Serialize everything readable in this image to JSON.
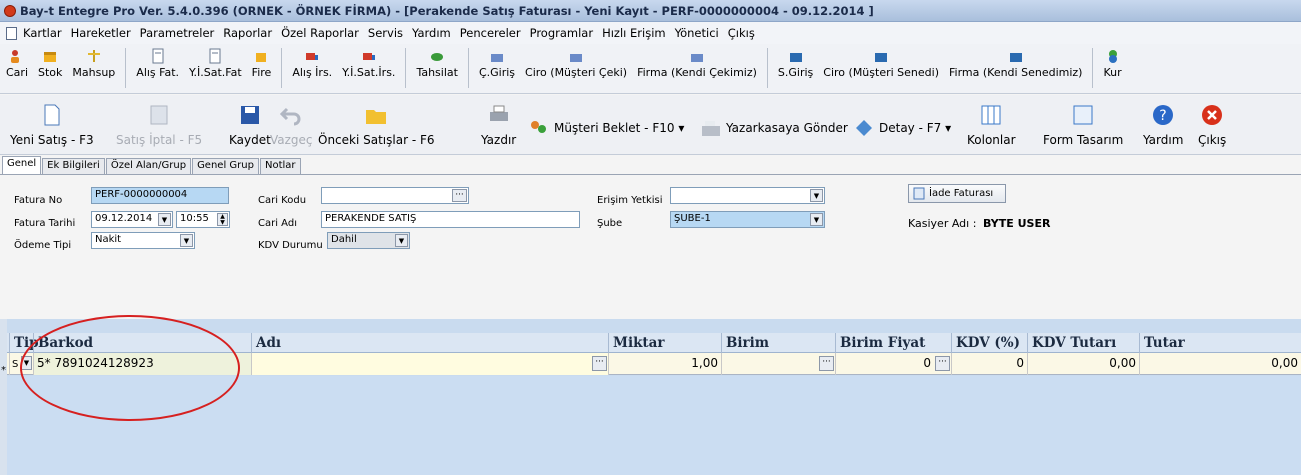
{
  "window": {
    "title": "Bay-t Entegre Pro Ver. 5.4.0.396 (ORNEK - ÖRNEK FİRMA) - [Perakende Satış Faturası - Yeni Kayıt - PERF-0000000004 - 09.12.2014 ]"
  },
  "menu": [
    "Kartlar",
    "Hareketler",
    "Parametreler",
    "Raporlar",
    "Özel Raporlar",
    "Servis",
    "Yardım",
    "Pencereler",
    "Programlar",
    "Hızlı Erişim",
    "Yönetici",
    "Çıkış"
  ],
  "toolbar1": [
    "Cari",
    "Stok",
    "Mahsup",
    "Alış Fat.",
    "Y.İ.Sat.Fat",
    "Fire",
    "Alış İrs.",
    "Y.İ.Sat.İrs.",
    "Tahsilat",
    "Ç.Giriş",
    "Ciro (Müşteri Çeki)",
    "Firma (Kendi Çekimiz)",
    "S.Giriş",
    "Ciro (Müşteri Senedi)",
    "Firma (Kendi Senedimiz)",
    "Kur"
  ],
  "toolbar2": {
    "yeni": "Yeni Satış - F3",
    "iptal": "Satış İptal - F5",
    "kaydet": "Kaydet",
    "vazgec": "Vazgeç",
    "onceki": "Önceki Satışlar - F6",
    "yazdir": "Yazdır",
    "musteri": "Müşteri Beklet - F10",
    "yazarkasa": "Yazarkasaya Gönder",
    "detay": "Detay - F7",
    "kolonlar": "Kolonlar",
    "form": "Form Tasarım",
    "yardim": "Yardım",
    "cikis": "Çıkış"
  },
  "tabs": [
    "Genel",
    "Ek Bilgileri",
    "Özel Alan/Grup",
    "Genel Grup",
    "Notlar"
  ],
  "form": {
    "fatura_no_label": "Fatura No",
    "fatura_no": "PERF-0000000004",
    "fatura_tarihi_label": "Fatura Tarihi",
    "tarih": "09.12.2014",
    "saat": "10:55",
    "odeme_tipi_label": "Ödeme Tipi",
    "odeme_tipi": "Nakit",
    "cari_kodu_label": "Cari Kodu",
    "cari_kodu": "",
    "cari_adi_label": "Cari Adı",
    "cari_adi": "PERAKENDE SATIŞ",
    "kdv_durumu_label": "KDV Durumu",
    "kdv_durumu": "Dahil",
    "erisim_label": "Erişim Yetkisi",
    "erisim": "",
    "sube_label": "Şube",
    "sube": "ŞUBE-1",
    "iade_button": "İade Faturası",
    "kasiyer_label": "Kasiyer Adı :",
    "kasiyer": "BYTE USER"
  },
  "grid": {
    "columns": [
      "Tip",
      "Barkod",
      "Adı",
      "Miktar",
      "Birim",
      "Birim Fiyat",
      "KDV (%)",
      "KDV Tutarı",
      "Tutar"
    ],
    "row": {
      "marker": "*",
      "tip": "S",
      "barkod": "5* 7891024128923",
      "adi": "",
      "miktar": "1,00",
      "birim": "",
      "birim_fiyat": "0",
      "kdv": "0",
      "kdv_tutari": "0,00",
      "tutar": "0,00"
    }
  },
  "colors": {
    "accent": "#b7d8f3",
    "annotation": "#d62020",
    "grid_bg": "#cbddf2"
  }
}
